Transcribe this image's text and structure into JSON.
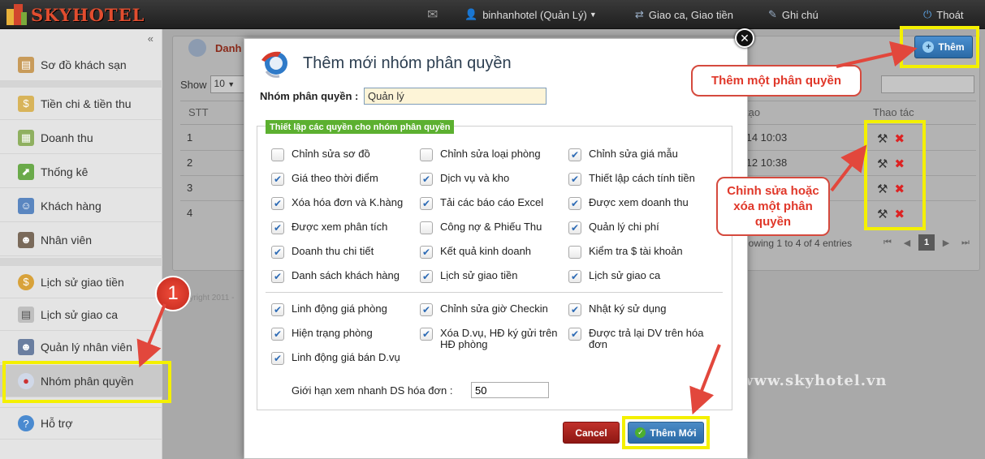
{
  "app": {
    "name": "SKYHOTEL"
  },
  "topnav": {
    "mail_icon": "envelope-icon",
    "user": "binhanhotel (Quản Lý)",
    "shift": "Giao ca, Giao tiền",
    "note": "Ghi chú",
    "logout": "Thoát"
  },
  "sidebar": {
    "collapse": "«",
    "items": [
      {
        "label": "Sơ đồ khách sạn",
        "icon": "map-icon"
      },
      {
        "label": "Tiền chi & tiền thu",
        "icon": "money-icon"
      },
      {
        "label": "Doanh thu",
        "icon": "calculator-icon"
      },
      {
        "label": "Thống kê",
        "icon": "chart-icon"
      },
      {
        "label": "Khách hàng",
        "icon": "customer-icon"
      },
      {
        "label": "Nhân viên",
        "icon": "staff-icon"
      },
      {
        "label": "Lịch sử giao tiền",
        "icon": "dollar-icon"
      },
      {
        "label": "Lịch sử giao ca",
        "icon": "document-icon"
      },
      {
        "label": "Quản lý nhân viên",
        "icon": "manager-icon"
      },
      {
        "label": "Nhóm phân quyền",
        "icon": "group-icon"
      },
      {
        "label": "Hỗ trợ",
        "icon": "help-icon"
      }
    ]
  },
  "main": {
    "title": "Danh",
    "show_label": "Show",
    "show_value": "10",
    "headers": {
      "stt": "STT",
      "created": "tạo",
      "actions": "Thao tác"
    },
    "rows": [
      {
        "stt": "1",
        "date": "/14 10:03"
      },
      {
        "stt": "2",
        "date": "/12 10:38"
      },
      {
        "stt": "3",
        "date": ""
      },
      {
        "stt": "4",
        "date": ""
      }
    ],
    "entries": "howing 1 to 4 of 4 entries",
    "pager": {
      "first": "⏮",
      "prev": "◀",
      "current": "1",
      "next": "▶",
      "last": "⏭"
    },
    "copyright": "pyright 2011 -",
    "watermark": "www.skyhotel.vn",
    "add_button": "Thêm"
  },
  "modal": {
    "title": "Thêm mới nhóm phân quyền",
    "group_label": "Nhóm phân quyền :",
    "group_value": "Quản lý",
    "section_label": "Thiết lập các quyền cho nhóm phân quyền",
    "permissions": [
      {
        "label": "Chỉnh sửa sơ đồ",
        "checked": false
      },
      {
        "label": "Chỉnh sửa loại phòng",
        "checked": false
      },
      {
        "label": "Chỉnh sửa giá mẫu",
        "checked": true
      },
      {
        "label": "Giá theo thời điểm",
        "checked": true
      },
      {
        "label": "Dịch vụ và kho",
        "checked": true
      },
      {
        "label": "Thiết lập cách tính tiền",
        "checked": true
      },
      {
        "label": "Xóa hóa đơn và K.hàng",
        "checked": true
      },
      {
        "label": "Tải các báo cáo Excel",
        "checked": true
      },
      {
        "label": "Được xem doanh thu",
        "checked": true
      },
      {
        "label": "Được xem phân tích",
        "checked": true
      },
      {
        "label": "Công nợ & Phiếu Thu",
        "checked": false
      },
      {
        "label": "Quản lý chi phí",
        "checked": true
      },
      {
        "label": "Doanh thu chi tiết",
        "checked": true
      },
      {
        "label": "Kết quả kinh doanh",
        "checked": true
      },
      {
        "label": "Kiểm tra $ tài khoản",
        "checked": false
      },
      {
        "label": "Danh sách khách hàng",
        "checked": true
      },
      {
        "label": "Lịch sử giao tiền",
        "checked": true
      },
      {
        "label": "Lịch sử giao ca",
        "checked": true
      },
      {
        "label": "Linh động giá phòng",
        "checked": true
      },
      {
        "label": "Chỉnh sửa giờ Checkin",
        "checked": true
      },
      {
        "label": "Nhật ký sử dụng",
        "checked": true
      },
      {
        "label": "Hiện trạng phòng",
        "checked": true
      },
      {
        "label": "Xóa D.vụ, HĐ ký gửi trên HĐ phòng",
        "checked": true
      },
      {
        "label": "Được trả lại DV trên hóa đơn",
        "checked": true
      },
      {
        "label": "Linh động giá bán D.vụ",
        "checked": true
      }
    ],
    "limit_label": "Giới hạn xem nhanh DS hóa đơn :",
    "limit_value": "50",
    "cancel": "Cancel",
    "submit": "Thêm Mới"
  },
  "annotations": {
    "add_callout": "Thêm một phân quyền",
    "edit_callout": "Chỉnh sửa hoặc xóa một phân quyền",
    "step": "1"
  },
  "colors": {
    "highlight": "#f4f000",
    "callout": "#e0382a",
    "accent": "#2a6aa6"
  }
}
